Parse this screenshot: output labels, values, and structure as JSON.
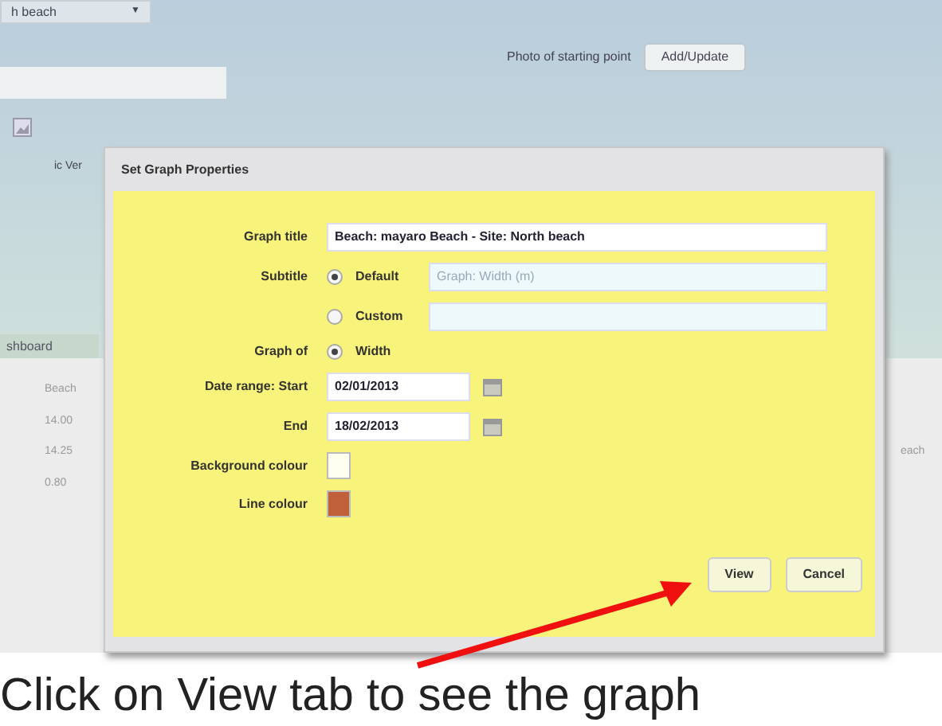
{
  "background": {
    "dropdown": {
      "value": "h beach",
      "caret": "▼"
    },
    "photo_label": "Photo of starting point",
    "add_button": "Add/Update",
    "side_text": "ic Ver",
    "tab": "shboard",
    "table": {
      "column_1": "Beach",
      "rows": [
        "14.00",
        "14.25",
        "0.80"
      ]
    },
    "right_text": "each"
  },
  "dialog": {
    "title": "Set Graph Properties",
    "graph_title": {
      "label": "Graph title",
      "value": "Beach: mayaro Beach  - Site: North beach"
    },
    "subtitle": {
      "label": "Subtitle",
      "options": [
        {
          "label": "Default",
          "selected": true,
          "value": "Graph: Width (m)",
          "disabled": true
        },
        {
          "label": "Custom",
          "selected": false,
          "disabled": true
        }
      ]
    },
    "graph_of": {
      "label": "Graph of",
      "options": [
        {
          "label": "Width",
          "selected": true
        }
      ]
    },
    "start": {
      "label": "Date range: Start",
      "value": "02/01/2013"
    },
    "end": {
      "label": "End",
      "value": "18/02/2013"
    },
    "background_colour": {
      "label": "Background colour",
      "color": "#fffff0"
    },
    "line_colour": {
      "label": "Line colour",
      "color": "#c0603a"
    },
    "buttons": [
      "View",
      "Cancel"
    ]
  },
  "caption": "Click on View tab to see the graph"
}
